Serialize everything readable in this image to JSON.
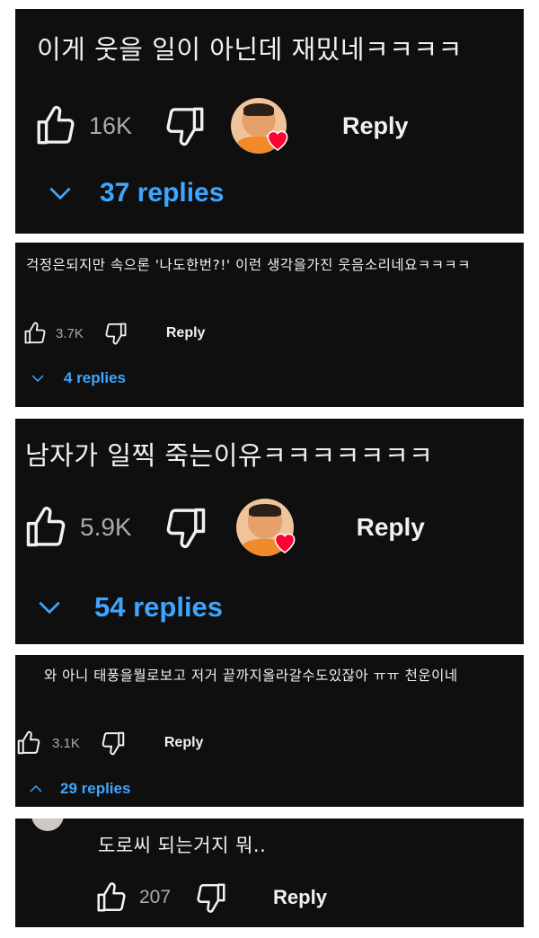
{
  "comments": [
    {
      "text": "이게 웃을 일이 아닌데 재밌네ㅋㅋㅋㅋ",
      "likes": "16K",
      "reply_label": "Reply",
      "replies": "37 replies",
      "replies_expanded": false,
      "creator_heart": true
    },
    {
      "text": "걱정은되지만 속으론 '나도한번?!' 이런 생각을가진 웃음소리네요ㅋㅋㅋㅋ",
      "likes": "3.7K",
      "reply_label": "Reply",
      "replies": "4 replies",
      "replies_expanded": false,
      "creator_heart": false
    },
    {
      "text": "남자가 일찍 죽는이유ㅋㅋㅋㅋㅋㅋㅋ",
      "likes": "5.9K",
      "reply_label": "Reply",
      "replies": "54 replies",
      "replies_expanded": false,
      "creator_heart": true
    },
    {
      "text": "와 아니 태풍을뭘로보고 저거 끝까지올라갈수도있잖아 ㅠㅠ 천운이네",
      "likes": "3.1K",
      "reply_label": "Reply",
      "replies": "29 replies",
      "replies_expanded": true,
      "creator_heart": false
    },
    {
      "text": "도로씨 되는거지 뭐..",
      "likes": "207",
      "reply_label": "Reply",
      "creator_heart": false
    }
  ],
  "colors": {
    "background": "#0f0f0f",
    "text": "#f1f1f1",
    "count": "#aaaaaa",
    "link": "#3ea6ff",
    "heart": "#ff0033"
  }
}
